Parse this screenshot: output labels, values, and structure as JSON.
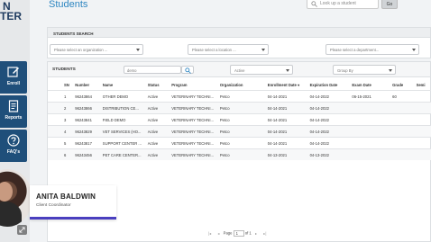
{
  "brand": {
    "line1": "N",
    "line2": "TER"
  },
  "sidebar": {
    "items": [
      {
        "label": "Enroll",
        "icon": "edit-icon"
      },
      {
        "label": "Reports",
        "icon": "report-icon"
      },
      {
        "label": "FAQ's",
        "icon": "question-icon"
      }
    ]
  },
  "header": {
    "title": "Students",
    "search_placeholder": "Look up a student",
    "go_label": "Go"
  },
  "search_panel": {
    "title": "STUDENTS SEARCH",
    "org_placeholder": "Please select an organization ...",
    "loc_placeholder": "Please select a location ...",
    "dept_placeholder": "Please select a department..."
  },
  "students": {
    "title": "STUDENTS",
    "search_value": "demo",
    "status_value": "Active",
    "group_value": "Group By",
    "columns": [
      "SN",
      "Number",
      "Name",
      "Status",
      "Program",
      "Organization",
      "Enrollment Date",
      "Expiration Date",
      "Exam Date",
      "Grade",
      "Semi"
    ],
    "rows": [
      [
        "1",
        "96243864",
        "OTHER DEMO",
        "Active",
        "VETERINARY TECHNI...",
        "Petco",
        "04-14-2021",
        "04-14-2022",
        "06-15-2021",
        "60",
        ""
      ],
      [
        "2",
        "96243866",
        "DISTRIBUTION CE...",
        "Active",
        "VETERINARY TECHNI...",
        "Petco",
        "04-14-2021",
        "04-14-2022",
        "",
        "",
        ""
      ],
      [
        "3",
        "96243841",
        "FIELD DEMO",
        "Active",
        "VETERINARY TECHNI...",
        "Petco",
        "04-14-2021",
        "04-14-2022",
        "",
        "",
        ""
      ],
      [
        "4",
        "96243829",
        "VET SERVICES (HO...",
        "Active",
        "VETERINARY TECHNI...",
        "Petco",
        "04-14-2021",
        "04-14-2022",
        "",
        "",
        ""
      ],
      [
        "5",
        "96243817",
        "SUPPORT CENTER ...",
        "Active",
        "VETERINARY TECHNI...",
        "Petco",
        "04-14-2021",
        "04-14-2022",
        "",
        "",
        ""
      ],
      [
        "6",
        "96243456",
        "PET CARE CENTER...",
        "Active",
        "VETERINARY TECHNI...",
        "Petco",
        "04-13-2021",
        "04-13-2022",
        "",
        "",
        ""
      ]
    ]
  },
  "pager": {
    "page_label": "Page",
    "page_value": "1",
    "of_label": "of 1"
  },
  "person": {
    "name": "ANITA BALDWIN",
    "role": "Client Coordinator"
  },
  "colors": {
    "nav": "#1f4f7a",
    "title": "#2e86c1",
    "accent": "#4a3fbf"
  }
}
